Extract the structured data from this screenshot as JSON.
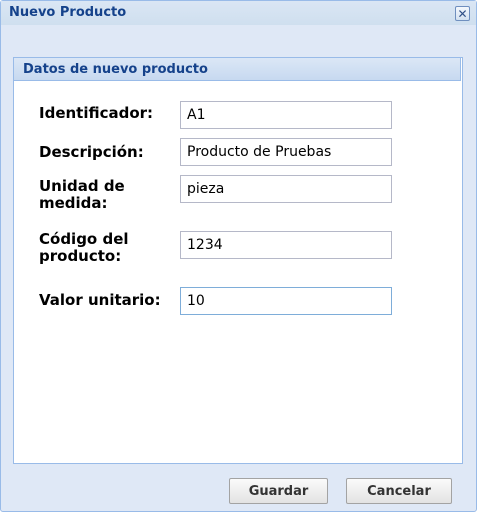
{
  "window": {
    "title": "Nuevo Producto",
    "close_icon": "close-icon"
  },
  "panel": {
    "title": "Datos de nuevo producto"
  },
  "form": {
    "identificador": {
      "label": "Identificador:",
      "value": "A1"
    },
    "descripcion": {
      "label": "Descripción:",
      "value": "Producto de Pruebas"
    },
    "unidad": {
      "label_line1": "Unidad de",
      "label_line2": "medida:",
      "value": "pieza"
    },
    "codigo": {
      "label_line1": "Código del",
      "label_line2": "producto:",
      "value": "1234"
    },
    "valor": {
      "label": "Valor unitario:",
      "value": "10"
    }
  },
  "buttons": {
    "save": "Guardar",
    "cancel": "Cancelar"
  },
  "colors": {
    "title_text": "#15428b",
    "window_bg": "#dfe8f6",
    "border": "#99bbe8"
  }
}
